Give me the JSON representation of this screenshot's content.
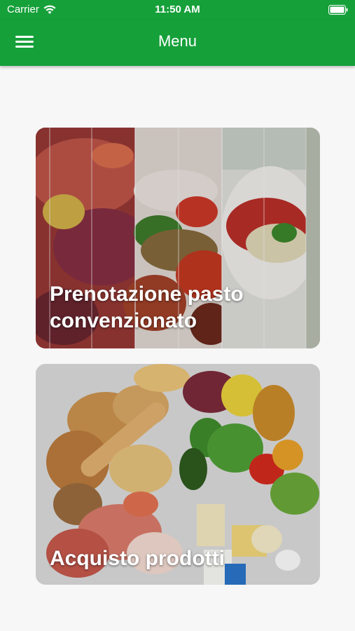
{
  "status_bar": {
    "carrier": "Carrier",
    "time": "11:50 AM"
  },
  "header": {
    "title": "Menu",
    "menu_icon": "hamburger-menu-icon",
    "color": "#16a03a"
  },
  "cards": [
    {
      "label": "Prenotazione pasto convenzionato",
      "image": "meal-photo-collage"
    },
    {
      "label": "Acquisto prodotti",
      "image": "grocery-food-assortment"
    }
  ]
}
